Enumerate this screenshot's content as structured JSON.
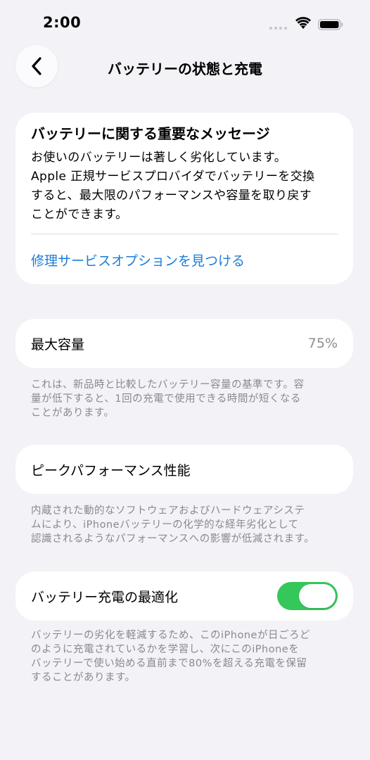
{
  "status": {
    "time": "2:00"
  },
  "nav": {
    "title": "バッテリーの状態と充電"
  },
  "message_card": {
    "title": "バッテリーに関する重要なメッセージ",
    "body_lines": [
      "お使いのバッテリーは著しく劣化しています。",
      "Apple 正規サービスプロバイダでバッテリーを交換",
      "すると、最大限のパフォーマンスや容量を取り戻す",
      "ことができます。"
    ],
    "link": "修理サービスオプションを見つける"
  },
  "max_capacity": {
    "label": "最大容量",
    "value": "75%",
    "footnote_lines": [
      "これは、新品時と比較したバッテリー容量の基準です。容",
      "量が低下すると、1回の充電で使用できる時間が短くなる",
      "ことがあります。"
    ]
  },
  "peak_performance": {
    "label": "ピークパフォーマンス性能",
    "footnote_lines": [
      "内蔵された動的なソフトウェアおよびハードウェアシステ",
      "ムにより、iPhoneバッテリーの化学的な経年劣化として",
      "認識されるようなパフォーマンスへの影響が低減されます。"
    ]
  },
  "charging_optimization": {
    "label": "バッテリー充電の最適化",
    "enabled": true,
    "footnote_lines": [
      "バッテリーの劣化を軽減するため、このiPhoneが日ごろど",
      "のように充電されているかを学習し、次にこのiPhoneを",
      "バッテリーで使い始める直前まで80%を超える充電を保留",
      "することがあります。"
    ]
  },
  "colors": {
    "accent": "#1b7cd8",
    "toggle_on": "#34c759",
    "background": "#f2f2f7"
  }
}
